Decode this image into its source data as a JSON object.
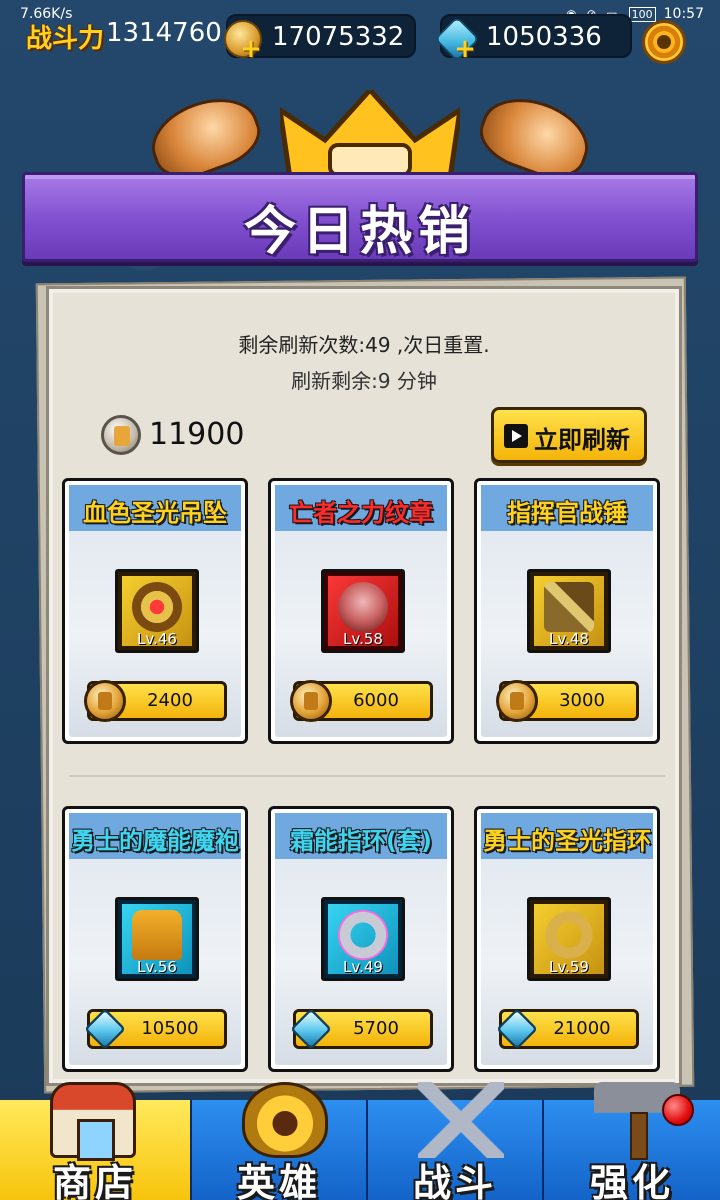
{
  "status_bar": {
    "network_speed": "7.66K/s",
    "battery": "100",
    "time": "10:57"
  },
  "top_bar": {
    "power_label": "战斗力",
    "power_value": "1314760",
    "gold_value": "17075332",
    "gem_value": "1050336"
  },
  "banner": {
    "title": "今日热销"
  },
  "shop": {
    "refresh_count_text": "剩余刷新次数:49 ,次日重置.",
    "refresh_timer_text": "刷新剩余:9 分钟",
    "balance": "11900",
    "refresh_button_label": "立即刷新"
  },
  "items": [
    {
      "name": "血色圣光吊坠",
      "level": "Lv.46",
      "price": "2400",
      "currency": "coin",
      "title_color": "#ffd21e",
      "frame": "gold"
    },
    {
      "name": "亡者之力纹章",
      "level": "Lv.58",
      "price": "6000",
      "currency": "coin",
      "title_color": "#ff2a2a",
      "frame": "red"
    },
    {
      "name": "指挥官战锤",
      "level": "Lv.48",
      "price": "3000",
      "currency": "coin",
      "title_color": "#ffd21e",
      "frame": "gold"
    },
    {
      "name": "勇士的魔能魔袍",
      "level": "Lv.56",
      "price": "10500",
      "currency": "gem",
      "title_color": "#3fd4f0",
      "frame": "blue"
    },
    {
      "name": "霜能指环(套)",
      "level": "Lv.49",
      "price": "5700",
      "currency": "gem",
      "title_color": "#3fd4f0",
      "frame": "blue"
    },
    {
      "name": "勇士的圣光指环",
      "level": "Lv.59",
      "price": "21000",
      "currency": "gem",
      "title_color": "#ffd21e",
      "frame": "gold"
    }
  ],
  "nav": {
    "tabs": [
      {
        "label": "商店",
        "icon": "shop-icon",
        "active": true
      },
      {
        "label": "英雄",
        "icon": "hero-helmet-icon",
        "active": false
      },
      {
        "label": "战斗",
        "icon": "crossed-swords-icon",
        "active": false
      },
      {
        "label": "强化",
        "icon": "forge-hammer-icon",
        "active": false
      }
    ]
  },
  "colors": {
    "background": "#1f3d5c",
    "banner_purple": "#7f4fcf",
    "button_yellow": "#f4b40a",
    "nav_blue": "#1463c8"
  }
}
